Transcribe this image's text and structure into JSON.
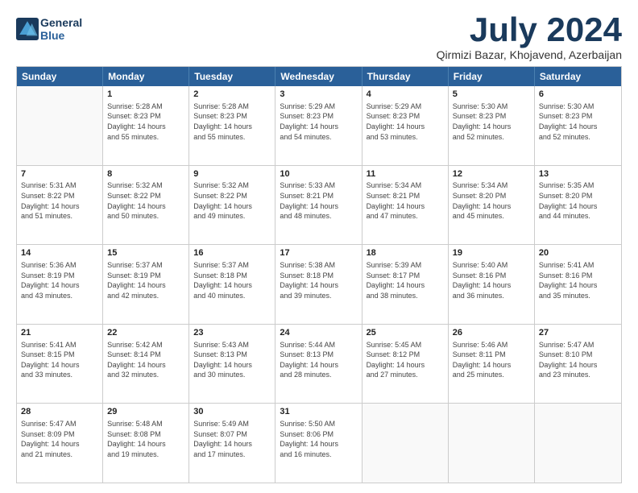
{
  "logo": {
    "line1": "General",
    "line2": "Blue"
  },
  "title": "July 2024",
  "subtitle": "Qirmizi Bazar, Khojavend, Azerbaijan",
  "header_days": [
    "Sunday",
    "Monday",
    "Tuesday",
    "Wednesday",
    "Thursday",
    "Friday",
    "Saturday"
  ],
  "rows": [
    [
      {
        "day": "",
        "info": ""
      },
      {
        "day": "1",
        "info": "Sunrise: 5:28 AM\nSunset: 8:23 PM\nDaylight: 14 hours\nand 55 minutes."
      },
      {
        "day": "2",
        "info": "Sunrise: 5:28 AM\nSunset: 8:23 PM\nDaylight: 14 hours\nand 55 minutes."
      },
      {
        "day": "3",
        "info": "Sunrise: 5:29 AM\nSunset: 8:23 PM\nDaylight: 14 hours\nand 54 minutes."
      },
      {
        "day": "4",
        "info": "Sunrise: 5:29 AM\nSunset: 8:23 PM\nDaylight: 14 hours\nand 53 minutes."
      },
      {
        "day": "5",
        "info": "Sunrise: 5:30 AM\nSunset: 8:23 PM\nDaylight: 14 hours\nand 52 minutes."
      },
      {
        "day": "6",
        "info": "Sunrise: 5:30 AM\nSunset: 8:23 PM\nDaylight: 14 hours\nand 52 minutes."
      }
    ],
    [
      {
        "day": "7",
        "info": "Sunrise: 5:31 AM\nSunset: 8:22 PM\nDaylight: 14 hours\nand 51 minutes."
      },
      {
        "day": "8",
        "info": "Sunrise: 5:32 AM\nSunset: 8:22 PM\nDaylight: 14 hours\nand 50 minutes."
      },
      {
        "day": "9",
        "info": "Sunrise: 5:32 AM\nSunset: 8:22 PM\nDaylight: 14 hours\nand 49 minutes."
      },
      {
        "day": "10",
        "info": "Sunrise: 5:33 AM\nSunset: 8:21 PM\nDaylight: 14 hours\nand 48 minutes."
      },
      {
        "day": "11",
        "info": "Sunrise: 5:34 AM\nSunset: 8:21 PM\nDaylight: 14 hours\nand 47 minutes."
      },
      {
        "day": "12",
        "info": "Sunrise: 5:34 AM\nSunset: 8:20 PM\nDaylight: 14 hours\nand 45 minutes."
      },
      {
        "day": "13",
        "info": "Sunrise: 5:35 AM\nSunset: 8:20 PM\nDaylight: 14 hours\nand 44 minutes."
      }
    ],
    [
      {
        "day": "14",
        "info": "Sunrise: 5:36 AM\nSunset: 8:19 PM\nDaylight: 14 hours\nand 43 minutes."
      },
      {
        "day": "15",
        "info": "Sunrise: 5:37 AM\nSunset: 8:19 PM\nDaylight: 14 hours\nand 42 minutes."
      },
      {
        "day": "16",
        "info": "Sunrise: 5:37 AM\nSunset: 8:18 PM\nDaylight: 14 hours\nand 40 minutes."
      },
      {
        "day": "17",
        "info": "Sunrise: 5:38 AM\nSunset: 8:18 PM\nDaylight: 14 hours\nand 39 minutes."
      },
      {
        "day": "18",
        "info": "Sunrise: 5:39 AM\nSunset: 8:17 PM\nDaylight: 14 hours\nand 38 minutes."
      },
      {
        "day": "19",
        "info": "Sunrise: 5:40 AM\nSunset: 8:16 PM\nDaylight: 14 hours\nand 36 minutes."
      },
      {
        "day": "20",
        "info": "Sunrise: 5:41 AM\nSunset: 8:16 PM\nDaylight: 14 hours\nand 35 minutes."
      }
    ],
    [
      {
        "day": "21",
        "info": "Sunrise: 5:41 AM\nSunset: 8:15 PM\nDaylight: 14 hours\nand 33 minutes."
      },
      {
        "day": "22",
        "info": "Sunrise: 5:42 AM\nSunset: 8:14 PM\nDaylight: 14 hours\nand 32 minutes."
      },
      {
        "day": "23",
        "info": "Sunrise: 5:43 AM\nSunset: 8:13 PM\nDaylight: 14 hours\nand 30 minutes."
      },
      {
        "day": "24",
        "info": "Sunrise: 5:44 AM\nSunset: 8:13 PM\nDaylight: 14 hours\nand 28 minutes."
      },
      {
        "day": "25",
        "info": "Sunrise: 5:45 AM\nSunset: 8:12 PM\nDaylight: 14 hours\nand 27 minutes."
      },
      {
        "day": "26",
        "info": "Sunrise: 5:46 AM\nSunset: 8:11 PM\nDaylight: 14 hours\nand 25 minutes."
      },
      {
        "day": "27",
        "info": "Sunrise: 5:47 AM\nSunset: 8:10 PM\nDaylight: 14 hours\nand 23 minutes."
      }
    ],
    [
      {
        "day": "28",
        "info": "Sunrise: 5:47 AM\nSunset: 8:09 PM\nDaylight: 14 hours\nand 21 minutes."
      },
      {
        "day": "29",
        "info": "Sunrise: 5:48 AM\nSunset: 8:08 PM\nDaylight: 14 hours\nand 19 minutes."
      },
      {
        "day": "30",
        "info": "Sunrise: 5:49 AM\nSunset: 8:07 PM\nDaylight: 14 hours\nand 17 minutes."
      },
      {
        "day": "31",
        "info": "Sunrise: 5:50 AM\nSunset: 8:06 PM\nDaylight: 14 hours\nand 16 minutes."
      },
      {
        "day": "",
        "info": ""
      },
      {
        "day": "",
        "info": ""
      },
      {
        "day": "",
        "info": ""
      }
    ]
  ]
}
